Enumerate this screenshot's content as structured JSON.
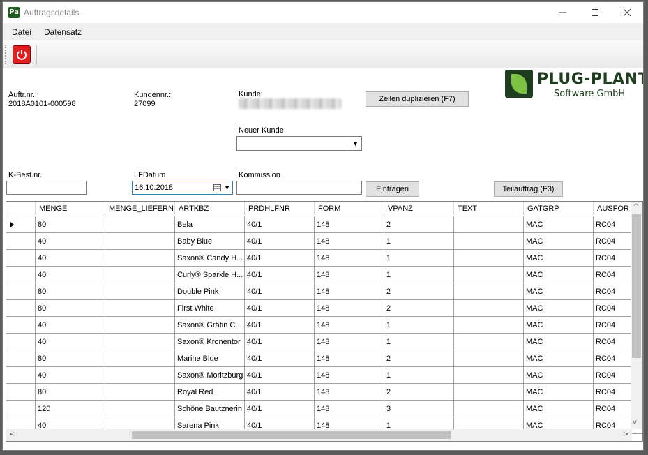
{
  "window": {
    "title": "Auftragsdetails",
    "icon_text": "Pa"
  },
  "menu": {
    "items": [
      "Datei",
      "Datensatz"
    ]
  },
  "header": {
    "auftr_label": "Auftr.nr.:",
    "auftr_value": "2018A0101-000598",
    "kunden_label": "Kundennr.:",
    "kunden_value": "27099",
    "kunde_label": "Kunde:",
    "neuer_kunde_label": "Neuer Kunde",
    "kbest_label": "K-Best.nr.",
    "lfdatum_label": "LFDatum",
    "lfdatum_value": "16.10.2018",
    "kommission_label": "Kommission"
  },
  "buttons": {
    "duplicate": "Zeilen duplizieren (F7)",
    "eintragen": "Eintragen",
    "teilauftrag": "Teilauftrag (F3)"
  },
  "logo": {
    "title": "PLUG-PLANT",
    "subtitle": "Software GmbH"
  },
  "grid": {
    "columns": [
      "MENGE",
      "MENGE_LIEFERN",
      "ARTKBZ",
      "PRDHLFNR",
      "FORM",
      "VPANZ",
      "TEXT",
      "GATGRP",
      "AUSFOR"
    ],
    "rows": [
      [
        "80",
        "",
        "Bela",
        "40/1",
        "148",
        "2",
        "",
        "MAC",
        "RC04"
      ],
      [
        "40",
        "",
        "Baby Blue",
        "40/1",
        "148",
        "1",
        "",
        "MAC",
        "RC04"
      ],
      [
        "40",
        "",
        "Saxon® Candy H...",
        "40/1",
        "148",
        "1",
        "",
        "MAC",
        "RC04"
      ],
      [
        "40",
        "",
        "Curly® Sparkle H...",
        "40/1",
        "148",
        "1",
        "",
        "MAC",
        "RC04"
      ],
      [
        "80",
        "",
        "Double Pink",
        "40/1",
        "148",
        "2",
        "",
        "MAC",
        "RC04"
      ],
      [
        "80",
        "",
        "First White",
        "40/1",
        "148",
        "2",
        "",
        "MAC",
        "RC04"
      ],
      [
        "40",
        "",
        "Saxon® Gräfin C...",
        "40/1",
        "148",
        "1",
        "",
        "MAC",
        "RC04"
      ],
      [
        "40",
        "",
        "Saxon® Kronentor",
        "40/1",
        "148",
        "1",
        "",
        "MAC",
        "RC04"
      ],
      [
        "80",
        "",
        "Marine Blue",
        "40/1",
        "148",
        "2",
        "",
        "MAC",
        "RC04"
      ],
      [
        "40",
        "",
        "Saxon® Moritzburg",
        "40/1",
        "148",
        "1",
        "",
        "MAC",
        "RC04"
      ],
      [
        "80",
        "",
        "Royal Red",
        "40/1",
        "148",
        "2",
        "",
        "MAC",
        "RC04"
      ],
      [
        "120",
        "",
        "Schöne Bautznerin",
        "40/1",
        "148",
        "3",
        "",
        "MAC",
        "RC04"
      ],
      [
        "40",
        "",
        "Sarena Pink",
        "40/1",
        "148",
        "1",
        "",
        "MAC",
        "RC04"
      ]
    ]
  },
  "colors": {
    "power": "#e02020",
    "brand": "#1e3d1e",
    "leaf": "#7dc242"
  },
  "icons": {
    "close": "close-icon",
    "maximize": "maximize-icon",
    "minimize": "minimize-icon",
    "power": "power-icon"
  }
}
